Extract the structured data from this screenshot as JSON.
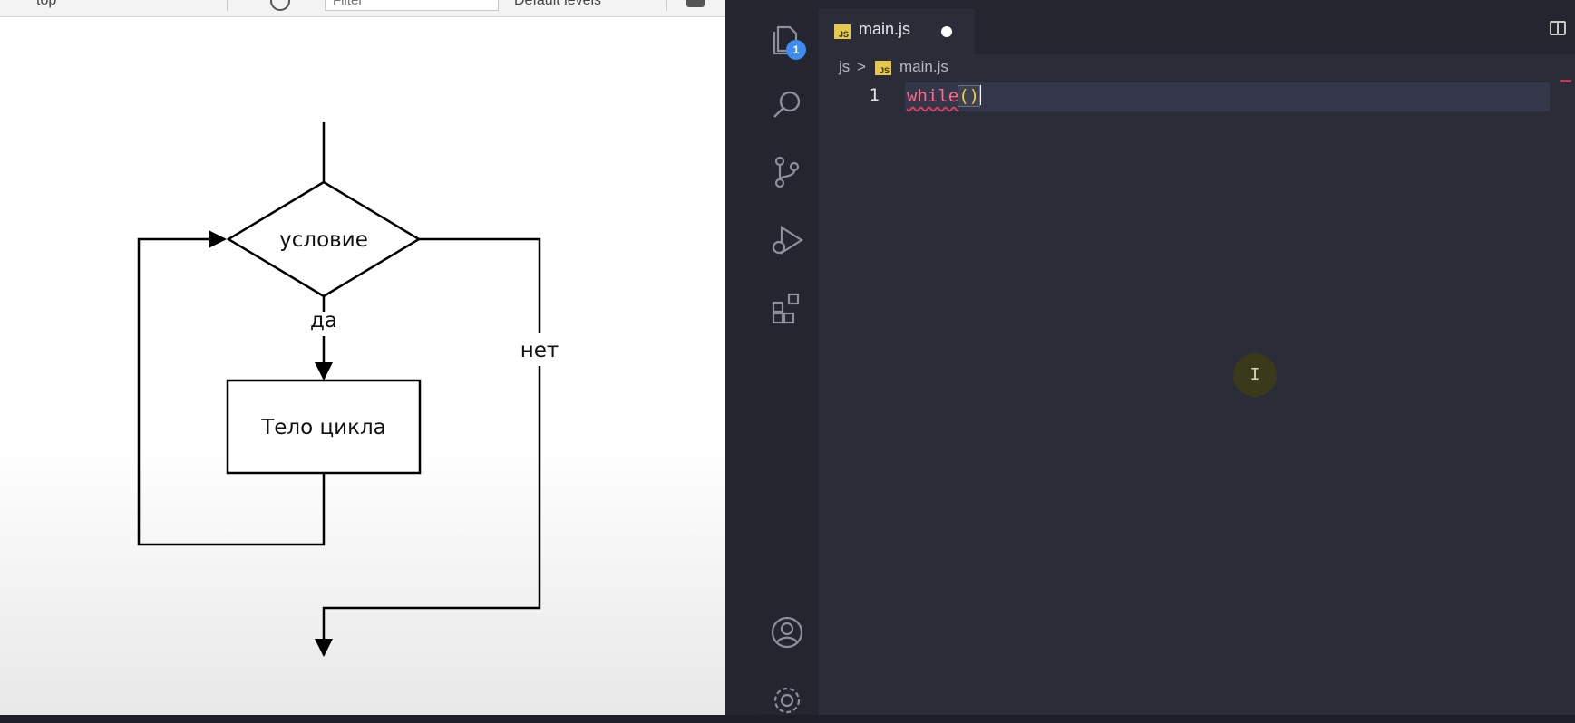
{
  "devtools": {
    "context": "top",
    "filter_placeholder": "Filter",
    "levels": "Default levels"
  },
  "flowchart": {
    "condition": "условие",
    "yes": "да",
    "no": "нет",
    "body": "Тело цикла"
  },
  "vscode": {
    "explorer_badge": "1",
    "tab": {
      "icon_text": "JS",
      "label": "main.js",
      "modified": true
    },
    "breadcrumb": {
      "folder": "js",
      "separator": ">",
      "file": "main.js"
    },
    "editor": {
      "line_number": "1",
      "keyword": "while",
      "parens": "()"
    },
    "mouse_cursor_glyph": "I",
    "icons": [
      "files-icon",
      "search-icon",
      "source-control-icon",
      "run-debug-icon",
      "extensions-icon",
      "account-icon",
      "settings-gear-icon",
      "split-editor-icon"
    ],
    "colors": {
      "keyword": "#ff6b8a",
      "bracket": "#f2d04b",
      "js_icon": "#e6c84a",
      "badge": "#3d8cf0"
    }
  }
}
